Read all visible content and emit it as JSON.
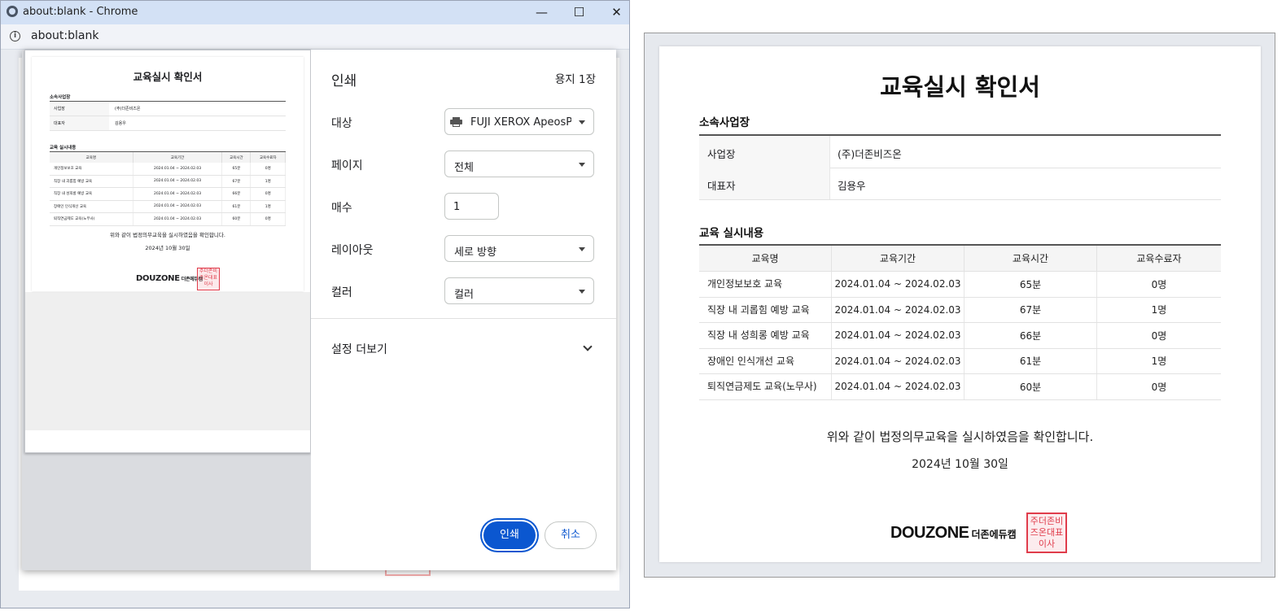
{
  "window": {
    "title": "about:blank - Chrome",
    "url": "about:blank",
    "controls": {
      "minimize": "—",
      "maximize": "☐",
      "close": "✕"
    }
  },
  "print": {
    "title": "인쇄",
    "sheets": "용지 1장",
    "destination": {
      "label": "대상",
      "value": "FUJI XEROX ApeosPort-\\"
    },
    "pages": {
      "label": "페이지",
      "value": "전체"
    },
    "copies": {
      "label": "매수",
      "value": "1"
    },
    "layout": {
      "label": "레이아웃",
      "value": "세로 방향"
    },
    "color": {
      "label": "컬러",
      "value": "컬러"
    },
    "more_settings": "설정 더보기",
    "print_button": "인쇄",
    "cancel_button": "취소"
  },
  "document": {
    "title": "교육실시 확인서",
    "section_workplace": "소속사업장",
    "workplace_key": "사업장",
    "workplace_value": "(주)더존비즈온",
    "rep_key": "대표자",
    "rep_value": "김용우",
    "section_training": "교육 실시내용",
    "columns": [
      "교육명",
      "교육기간",
      "교육시간",
      "교육수료자"
    ],
    "rows": [
      [
        "개인정보보호 교육",
        "2024.01.04 ~ 2024.02.03",
        "65분",
        "0명"
      ],
      [
        "직장 내 괴롭힘 예방 교육",
        "2024.01.04 ~ 2024.02.03",
        "67분",
        "1명"
      ],
      [
        "직장 내 성희롱 예방 교육",
        "2024.01.04 ~ 2024.02.03",
        "66분",
        "0명"
      ],
      [
        "장애인 인식개선 교육",
        "2024.01.04 ~ 2024.02.03",
        "61분",
        "1명"
      ],
      [
        "퇴직연금제도 교육(노무사)",
        "2024.01.04 ~ 2024.02.03",
        "60분",
        "0명"
      ]
    ],
    "confirmation": "위와 같이 법정의무교육을 실시하였음을 확인합니다.",
    "date": "2024년 10월 30일",
    "logo_main": "DOUZONE",
    "logo_sub": "더존에듀캠",
    "seal_text": "주더존비즈온대표이사"
  }
}
